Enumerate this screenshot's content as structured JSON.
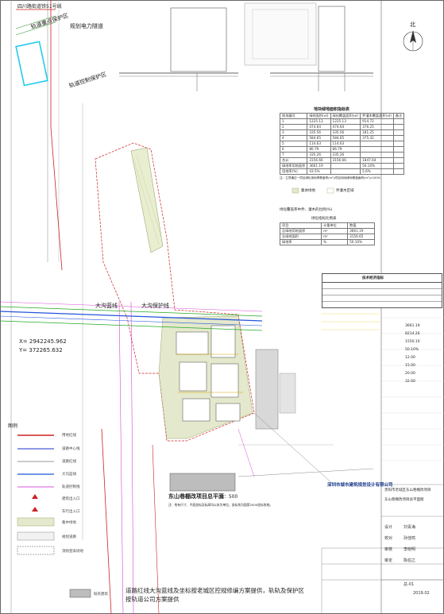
{
  "map_labels": {
    "zone_top_left": "四川路街道铁51号线",
    "track_zone": "轨道重点保护区",
    "power_corridor": "规划电力隧道",
    "track_control": "轨道控制保护区",
    "canal_blue_line": "大沟蓝线",
    "canal_protect": "大沟保护线",
    "coord_x": "X= 2942245.962",
    "coord_y": "Y= 372265.632",
    "legend_title": "图例",
    "project_title": "东山巷棚改项目总平面",
    "scale": "1：500",
    "project_note": "注：所有尺寸、平面坐标及标高均以米为单位，坐标系为国家2000坐标系统。",
    "disclaimer": "道路红线大沟蓝线及坐标按老城区控规修编方案提供，轨轨及保护区按轨道公司方案提供",
    "north": "北"
  },
  "green_table": {
    "title": "地块绿地面积指标表",
    "headers": [
      "地块编号",
      "绿地面积(㎡)",
      "绿化覆盖面积(㎡)",
      "乔灌木覆盖面积(㎡)",
      "备注"
    ],
    "rows": [
      [
        "1",
        "1225.13",
        "1225.13",
        "914.72",
        ""
      ],
      [
        "2",
        "474.64",
        "474.64",
        "376.25",
        ""
      ],
      [
        "3",
        "335.56",
        "335.56",
        "181.25",
        ""
      ],
      [
        "4",
        "584.65",
        "584.65",
        "375.42",
        ""
      ],
      [
        "5",
        "114.63",
        "114.63",
        "",
        ""
      ],
      [
        "6",
        "86.79",
        "86.79",
        "",
        ""
      ],
      [
        "7",
        "335.26",
        "335.26",
        "",
        ""
      ],
      [
        "合计",
        "3156.66",
        "3156.66",
        "1847.64",
        ""
      ]
    ],
    "rate_rows": [
      [
        "绿地率用地面积",
        "3661.19",
        "",
        "50.10%"
      ],
      [
        "用地率(%)",
        "43.5%",
        "",
        "5.6%"
      ]
    ],
    "footer": "注：立项通过一项目绿化用地率覆盖率(m²)/项目用地绿地覆盖面积(m²)×100%"
  },
  "map_legend_small": {
    "item1": "集体绿地",
    "item2": "乔灌木区域"
  },
  "summary_note": "绿化覆盖率中乔、灌木的比例(%)",
  "summary_table": {
    "title": "绿化指标比例表",
    "headers": [
      "项目",
      "计量单位",
      "数值"
    ],
    "rows": [
      [
        "总绿地用地面积",
        "m²",
        "3661.19"
      ],
      [
        "总绿地面积",
        "m²",
        "3156.65"
      ],
      [
        "绿地率",
        "%",
        "50.10%"
      ]
    ]
  },
  "tech_table": {
    "title": "技术经济指标",
    "values": [
      "3661.19",
      "8214.26",
      "1550.10",
      "50.10%"
    ]
  },
  "legend": [
    {
      "label": "用地红线",
      "color": "#cc2222"
    },
    {
      "label": "道路中心线",
      "color": "#2233cc"
    },
    {
      "label": "道路红线",
      "color": "#777777"
    },
    {
      "label": "大沟蓝线",
      "color": "#2255dd"
    },
    {
      "label": "轨道控制线",
      "color": "#cc22cc"
    },
    {
      "label": "建筑出入口",
      "color": "#cc2222"
    },
    {
      "label": "车行出入口",
      "color": "#cc2222"
    },
    {
      "label": "集中绿地",
      "color": "#9aae6f"
    },
    {
      "label": "规划道路",
      "color": "#888888"
    },
    {
      "label": "消防登高场地",
      "color": "#555555"
    },
    {
      "label": "既有建筑",
      "color": "#999999"
    }
  ],
  "title_block": {
    "company": "深圳市城市建筑规划设计有限公司",
    "project_name": "贵阳市老城区东山巷棚改项目",
    "drawing_name": "东山巷棚改项目总平面图",
    "signatures": [
      "设计",
      "校对",
      "审核",
      "审定"
    ],
    "names": [
      "刘青海",
      "孙佳鸣",
      "李晓明",
      "陈伯之"
    ],
    "date": "2019.02",
    "sheet": "总-01"
  },
  "right_numbers": [
    "3661.19",
    "8214.26",
    "1550.10",
    "50.10%",
    "12.00",
    "15.00",
    "20.00",
    "32.00"
  ]
}
